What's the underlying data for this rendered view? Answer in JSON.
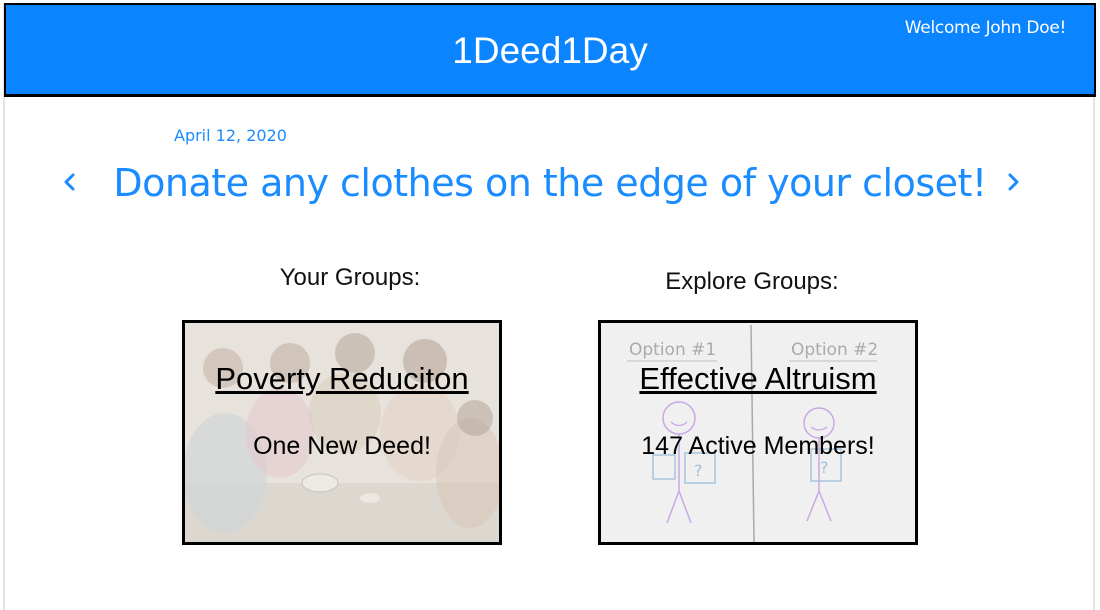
{
  "app": {
    "title": "1Deed1Day",
    "welcome": "Welcome John Doe!"
  },
  "deed": {
    "date": "April 12, 2020",
    "text": "Donate any clothes on the edge of your closet!"
  },
  "sections": {
    "your_groups": "Your Groups:",
    "explore_groups": "Explore Groups:"
  },
  "your_group": {
    "name": "Poverty Reduciton",
    "status": "One New Deed!"
  },
  "explore_group": {
    "name": "Effective Altruism",
    "status": "147 Active Members!",
    "image_labels": [
      "Option #1",
      "Option #2"
    ]
  },
  "colors": {
    "accent": "#0a84ff",
    "link_blue": "#1a8cff"
  },
  "icons": {
    "prev": "chevron-left-icon",
    "next": "chevron-right-icon"
  }
}
